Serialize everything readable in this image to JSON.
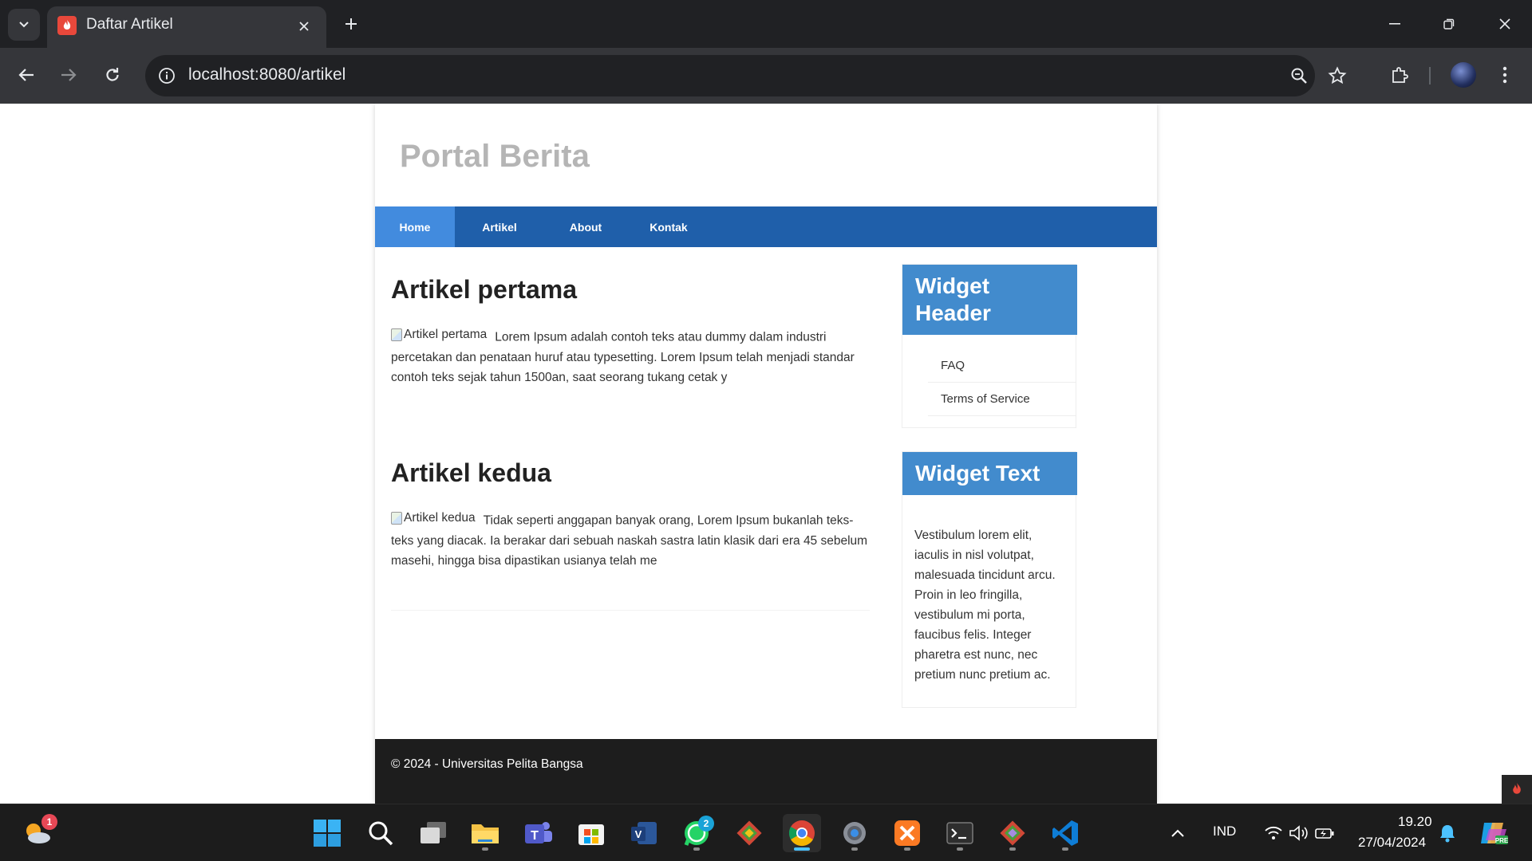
{
  "browser": {
    "tab_title": "Daftar Artikel",
    "url": "localhost:8080/artikel"
  },
  "site": {
    "title": "Portal Berita",
    "nav": [
      {
        "label": "Home",
        "active": true
      },
      {
        "label": "Artikel",
        "active": false
      },
      {
        "label": "About",
        "active": false
      },
      {
        "label": "Kontak",
        "active": false
      }
    ],
    "articles": [
      {
        "title": "Artikel pertama",
        "image_alt": "Artikel pertama",
        "excerpt": "Lorem Ipsum adalah contoh teks atau dummy dalam industri percetakan dan penataan huruf atau typesetting. Lorem Ipsum telah menjadi standar contoh teks sejak tahun 1500an, saat seorang tukang cetak y"
      },
      {
        "title": "Artikel kedua",
        "image_alt": "Artikel kedua",
        "excerpt": "Tidak seperti anggapan banyak orang, Lorem Ipsum bukanlah teks-teks yang diacak. Ia berakar dari sebuah naskah sastra latin klasik dari era 45 sebelum masehi, hingga bisa dipastikan usianya telah me"
      }
    ],
    "widget_header": {
      "title": "Widget Header",
      "links": [
        "FAQ",
        "Terms of Service"
      ]
    },
    "widget_text": {
      "title": "Widget Text",
      "body": "Vestibulum lorem elit, iaculis in nisl volutpat, malesuada tincidunt arcu. Proin in leo fringilla, vestibulum mi porta, faucibus felis. Integer pharetra est nunc, nec pretium nunc pretium ac."
    },
    "footer": "© 2024 - Universitas Pelita Bangsa"
  },
  "taskbar": {
    "weather_badge": "1",
    "whatsapp_badge": "2",
    "language": "IND",
    "time": "19.20",
    "date": "27/04/2024",
    "apps": [
      "start-icon",
      "search-icon",
      "task-view-icon",
      "file-explorer-icon",
      "teams-icon",
      "microsoft-store-icon",
      "visio-icon",
      "whatsapp-icon",
      "git-icon",
      "chrome-icon",
      "settings-icon",
      "xampp-icon",
      "terminal-icon",
      "git-gui-icon",
      "vscode-icon"
    ]
  },
  "colors": {
    "navbar": "#1f5faa",
    "nav_active": "#428bde",
    "widget_header": "#428bcd",
    "footer": "#1d1d1d",
    "site_title": "#b5b5b5"
  }
}
